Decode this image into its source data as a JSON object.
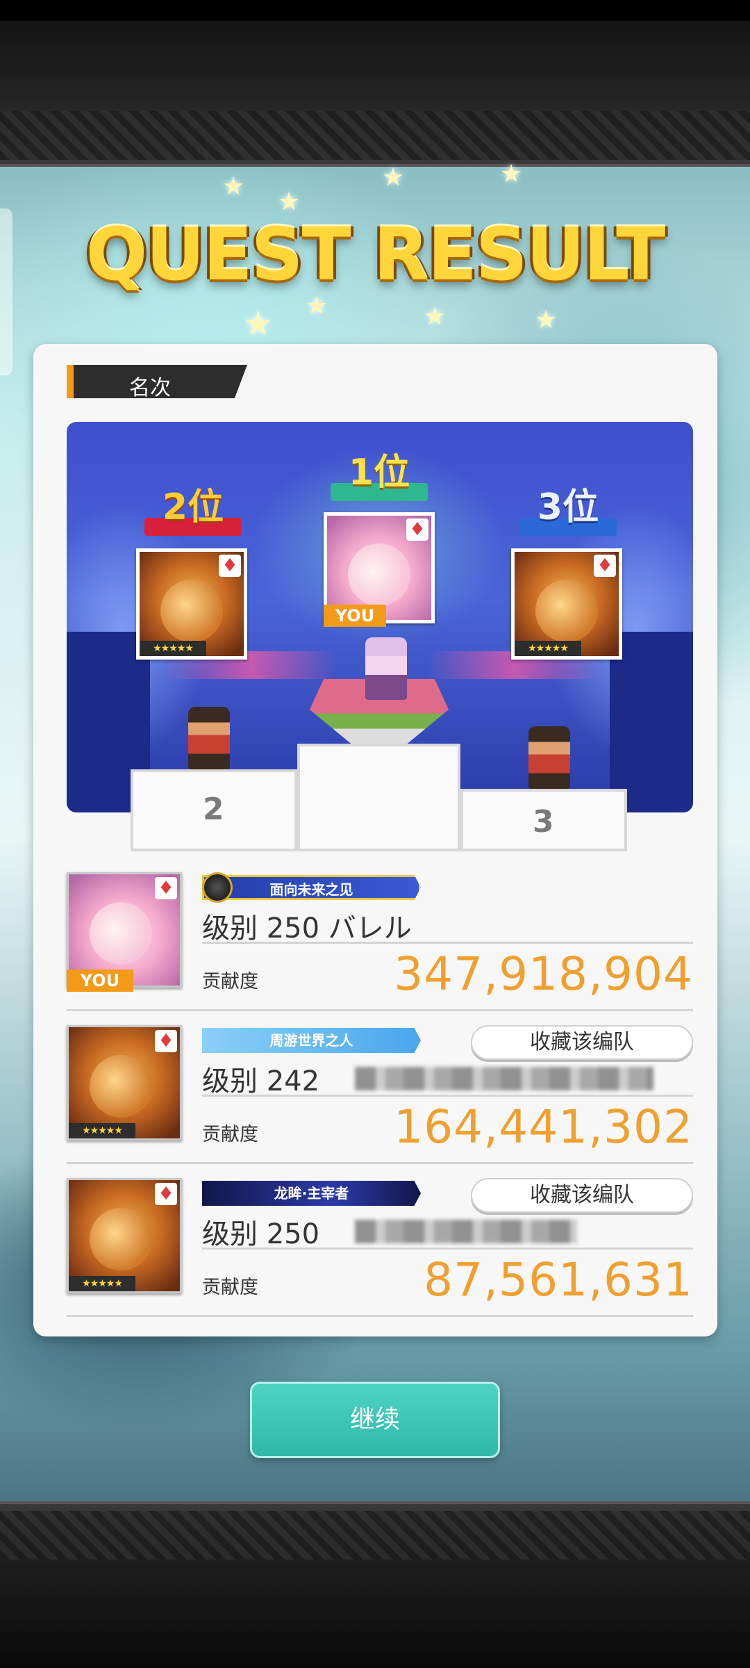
{
  "title": "QUEST RESULT",
  "section": {
    "label": "名次"
  },
  "podium": {
    "first": {
      "rank_label": "1位",
      "you": "YOU",
      "suit": "♦"
    },
    "second": {
      "rank_label": "2位",
      "suit": "♦",
      "stars": "★★★★★"
    },
    "third": {
      "rank_label": "3位",
      "suit": "♦",
      "stars": "★★★★★"
    },
    "num2": "2",
    "num3": "3"
  },
  "results": [
    {
      "title_badge": "面向未来之见",
      "level": "级别 250 バレル",
      "contrib_label": "贡献度",
      "contrib_value": "347,918,904",
      "you": "YOU",
      "suit": "♦"
    },
    {
      "title_badge": "周游世界之人",
      "level": "级别 242",
      "contrib_label": "贡献度",
      "contrib_value": "164,441,302",
      "fav_button": "收藏该编队",
      "suit": "♦",
      "stars": "★★★★★"
    },
    {
      "title_badge": "龙眸·主宰者",
      "level": "级别 250",
      "contrib_label": "贡献度",
      "contrib_value": "87,561,631",
      "fav_button": "收藏该编队",
      "suit": "♦",
      "stars": "★★★★★"
    }
  ],
  "continue_label": "继续",
  "colors": {
    "accent_orange": "#f0a030",
    "teal": "#2fb8a8",
    "gold": "#ffd63a"
  }
}
